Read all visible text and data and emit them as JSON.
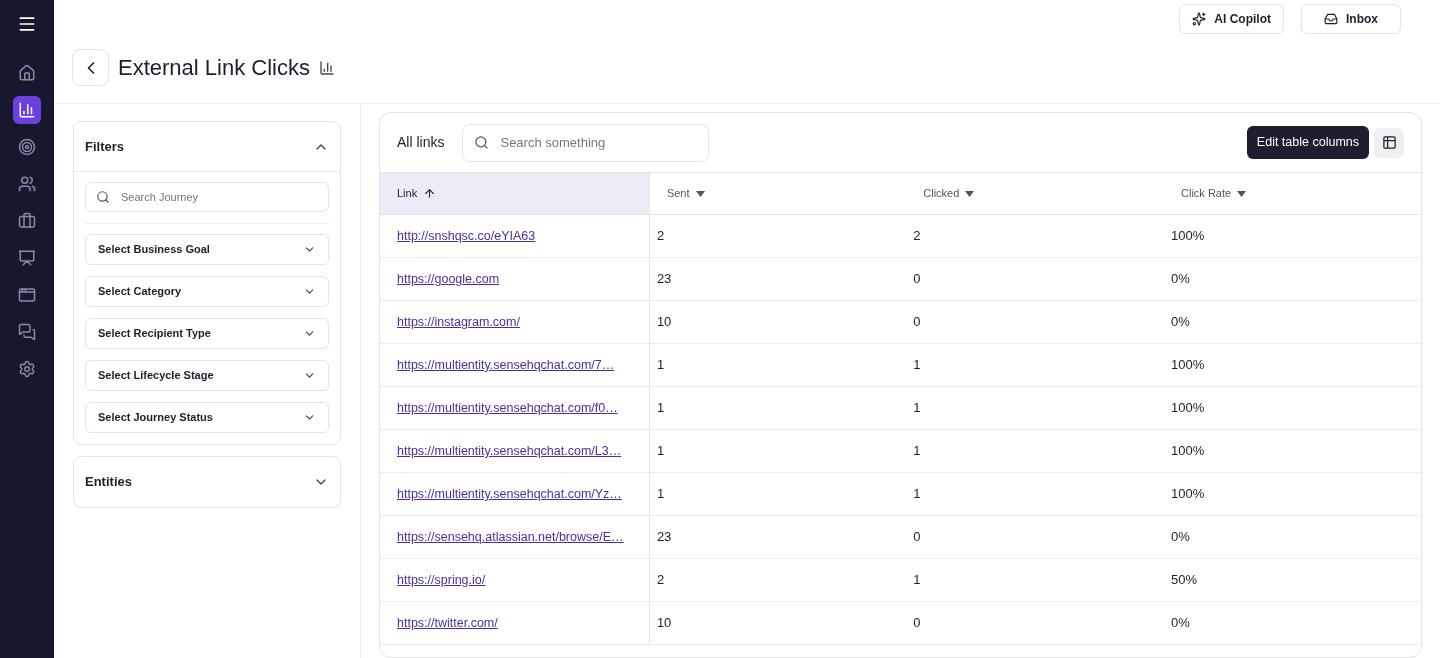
{
  "sidebar": {
    "items": [
      {
        "kind": "home",
        "selected": false
      },
      {
        "kind": "chart",
        "selected": true
      },
      {
        "kind": "target",
        "selected": false
      },
      {
        "kind": "people",
        "selected": false
      },
      {
        "kind": "briefcase",
        "selected": false
      },
      {
        "kind": "team",
        "selected": false
      },
      {
        "kind": "window",
        "selected": false
      },
      {
        "kind": "chat",
        "selected": false
      },
      {
        "kind": "gear",
        "selected": false
      }
    ]
  },
  "header": {
    "buttons": [
      {
        "kind": "sparkle",
        "label": "AI Copilot"
      },
      {
        "kind": "inbox",
        "label": "Inbox"
      }
    ]
  },
  "page": {
    "title": "External Link Clicks"
  },
  "filters": {
    "title": "Filters",
    "expanded": true,
    "search": {
      "placeholder": "Search Journey"
    },
    "selects": [
      "Select Business Goal",
      "Select Category",
      "Select Recipient Type",
      "Select Lifecycle Stage",
      "Select Journey Status"
    ]
  },
  "entities": {
    "title": "Entities",
    "expanded": false
  },
  "links_panel": {
    "title": "All links",
    "search": {
      "placeholder": "Search something"
    },
    "tooltip": "Edit table columns"
  },
  "table": {
    "columns": [
      {
        "label": "Link",
        "sorted": true,
        "selected": true
      },
      {
        "label": "Sent",
        "sorted": false,
        "selected": false
      },
      {
        "label": "Clicked",
        "sorted": false,
        "selected": false
      },
      {
        "label": "Click Rate",
        "sorted": false,
        "selected": false
      }
    ],
    "rows": [
      [
        "http://snshqsc.co/eYIA63",
        "2",
        "2",
        "100%"
      ],
      [
        "https://google.com",
        "23",
        "0",
        "0%"
      ],
      [
        "https://instagram.com/",
        "10",
        "0",
        "0%"
      ],
      [
        "https://multientity.sensehqchat.com/7…",
        "1",
        "1",
        "100%"
      ],
      [
        "https://multientity.sensehqchat.com/f0…",
        "1",
        "1",
        "100%"
      ],
      [
        "https://multientity.sensehqchat.com/L3…",
        "1",
        "1",
        "100%"
      ],
      [
        "https://multientity.sensehqchat.com/Yz…",
        "1",
        "1",
        "100%"
      ],
      [
        "https://sensehq.atlassian.net/browse/E…",
        "23",
        "0",
        "0%"
      ],
      [
        "https://spring.io/",
        "2",
        "1",
        "50%"
      ],
      [
        "https://twitter.com/",
        "10",
        "0",
        "0%"
      ]
    ]
  }
}
